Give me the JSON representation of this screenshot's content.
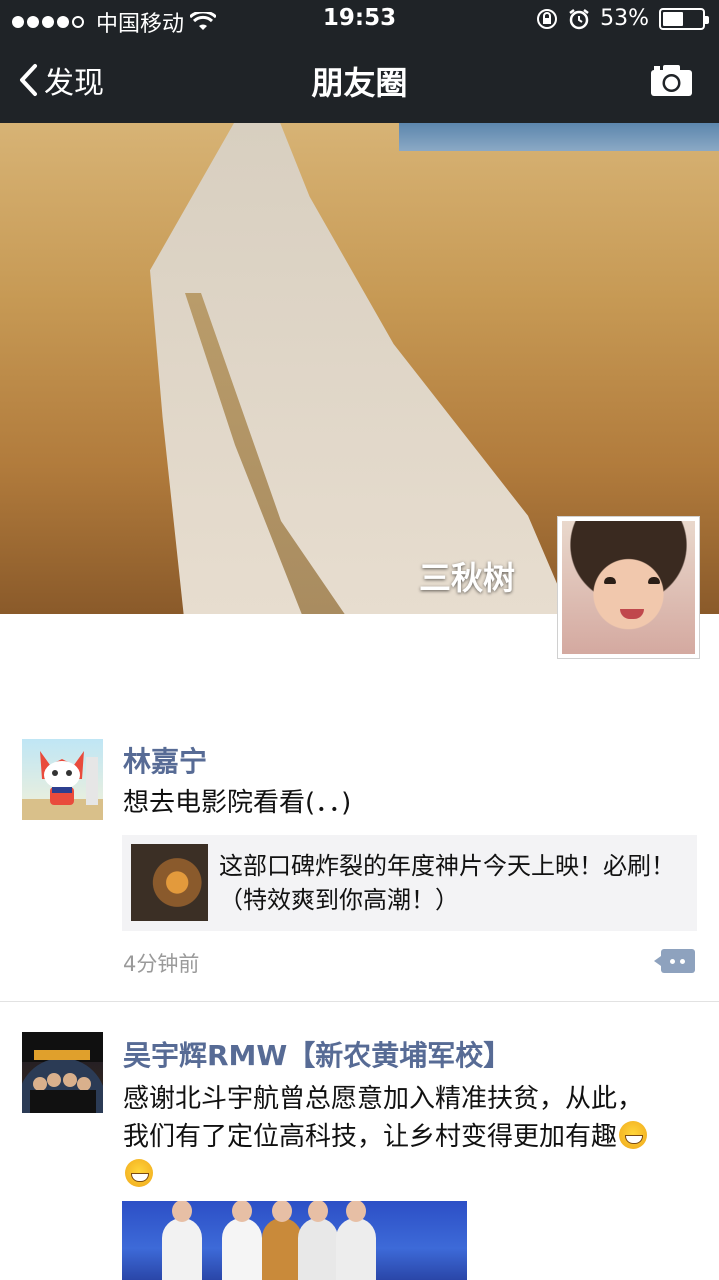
{
  "status_bar": {
    "carrier": "中国移动",
    "time": "19:53",
    "battery_percent": "53%",
    "battery_level": 0.53
  },
  "nav": {
    "back_label": "发现",
    "title": "朋友圈"
  },
  "profile": {
    "name": "三秋树"
  },
  "posts": [
    {
      "author": "林嘉宁",
      "text": "想去电影院看看(．．)",
      "link_title": "这部口碑炸裂的年度神片今天上映！必刷！（特效爽到你高潮！）",
      "time": "4分钟前"
    },
    {
      "author": "吴宇辉RMW【新农黄埔军校】",
      "text": "感谢北斗宇航曾总愿意加入精准扶贫，从此，我们有了定位高科技，让乡村变得更加有趣"
    }
  ],
  "icons": {
    "back": "chevron-left-icon",
    "camera": "camera-icon",
    "wifi": "wifi-icon",
    "lock": "orientation-lock-icon",
    "alarm": "alarm-icon",
    "comment": "comment-icon",
    "emoji": "grinning-emoji-icon"
  },
  "colors": {
    "nav_bg": "#1f2327",
    "author_link": "#576b95",
    "comment_button": "#8ea2be"
  }
}
